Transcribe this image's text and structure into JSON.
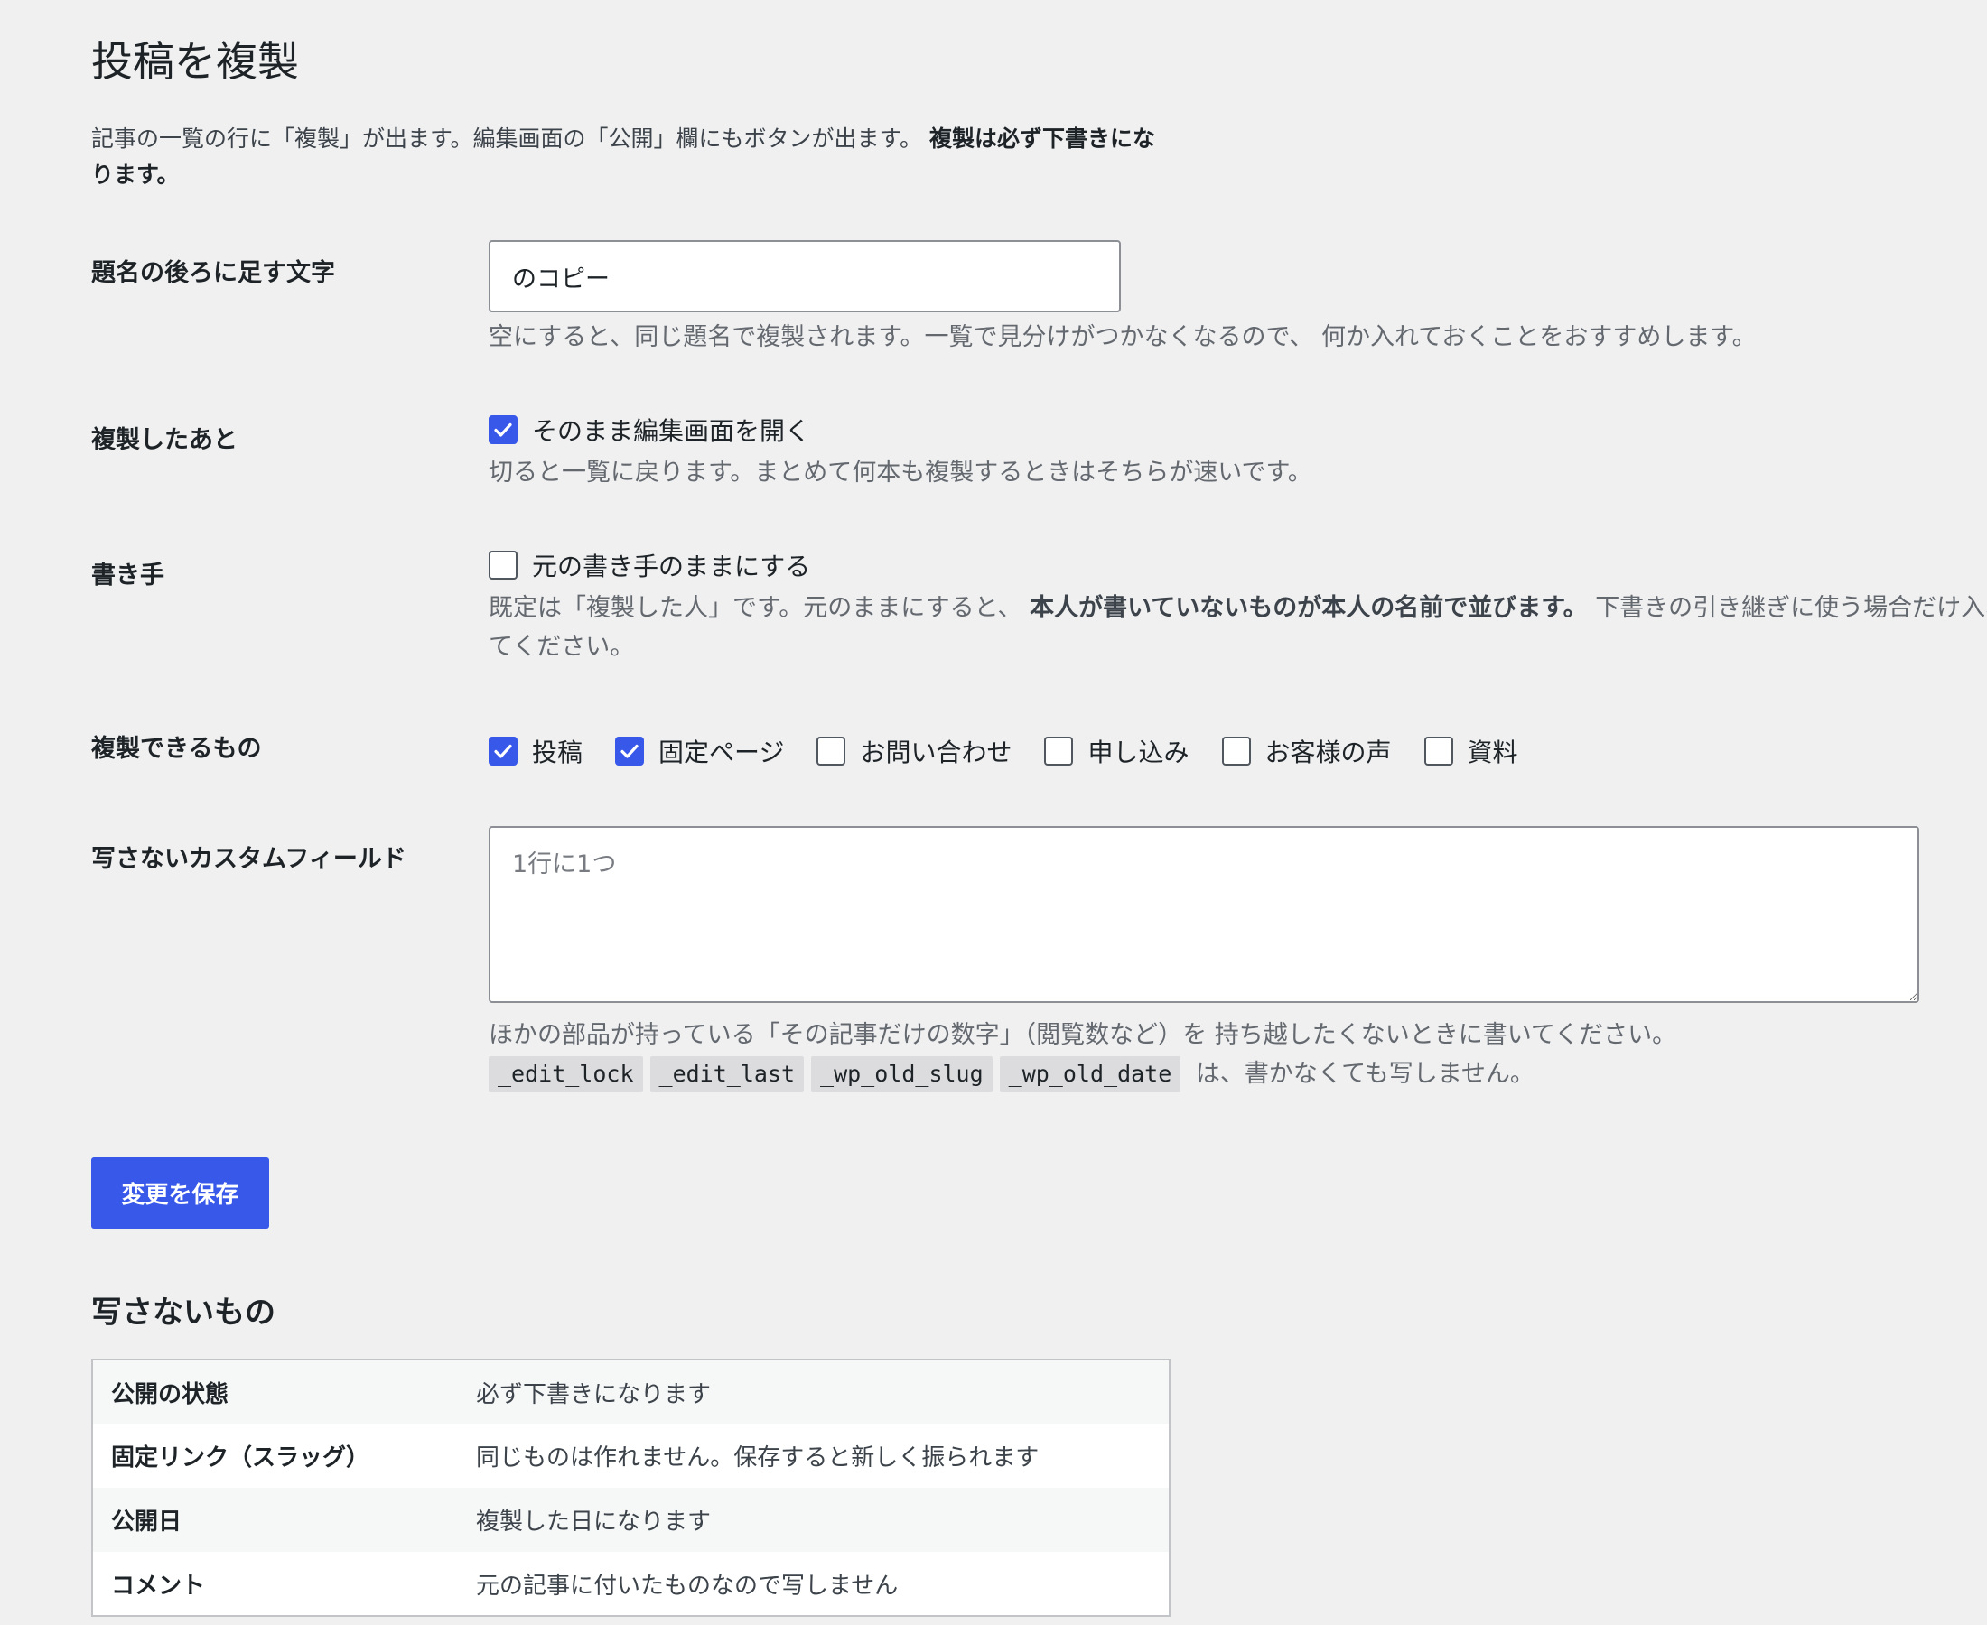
{
  "page": {
    "title": "投稿を複製",
    "intro_text": "記事の一覧の行に「複製」が出ます。編集画面の「公開」欄にもボタンが出ます。",
    "intro_bold": "複製は必ず下書きになります。"
  },
  "suffix": {
    "label": "題名の後ろに足す文字",
    "value": "のコピー",
    "description": "空にすると、同じ題名で複製されます。一覧で見分けがつかなくなるので、 何か入れておくことをおすすめします。"
  },
  "after_duplicate": {
    "label": "複製したあと",
    "checkbox_label": "そのまま編集画面を開く",
    "checked": true,
    "description": "切ると一覧に戻ります。まとめて何本も複製するときはそちらが速いです。"
  },
  "author": {
    "label": "書き手",
    "checkbox_label": "元の書き手のままにする",
    "checked": false,
    "description_before": "既定は「複製した人」です。元のままにすると、",
    "description_bold": "本人が書いていないものが本人の名前で並びます。",
    "description_after": "下書きの引き継ぎに使う場合だけ入れてください。"
  },
  "post_types": {
    "label": "複製できるもの",
    "items": [
      {
        "label": "投稿",
        "checked": true
      },
      {
        "label": "固定ページ",
        "checked": true
      },
      {
        "label": "お問い合わせ",
        "checked": false
      },
      {
        "label": "申し込み",
        "checked": false
      },
      {
        "label": "お客様の声",
        "checked": false
      },
      {
        "label": "資料",
        "checked": false
      }
    ]
  },
  "custom_fields": {
    "label": "写さないカスタムフィールド",
    "placeholder": "1行に1つ",
    "value": "",
    "description": "ほかの部品が持っている「その記事だけの数字」（閲覧数など）を 持ち越したくないときに書いてください。",
    "keys": [
      "_edit_lock",
      "_edit_last",
      "_wp_old_slug",
      "_wp_old_date"
    ],
    "keys_suffix": "は、書かなくても写しません。"
  },
  "save_button": {
    "label": "変更を保存"
  },
  "excluded": {
    "title": "写さないもの",
    "rows": [
      {
        "key": "公開の状態",
        "value": "必ず下書きになります"
      },
      {
        "key": "固定リンク（スラッグ）",
        "value": "同じものは作れません。保存すると新しく振られます"
      },
      {
        "key": "公開日",
        "value": "複製した日になります"
      },
      {
        "key": "コメント",
        "value": "元の記事に付いたものなので写しません"
      }
    ]
  },
  "colors": {
    "accent": "#3858e9",
    "background": "#f0f0f1"
  }
}
